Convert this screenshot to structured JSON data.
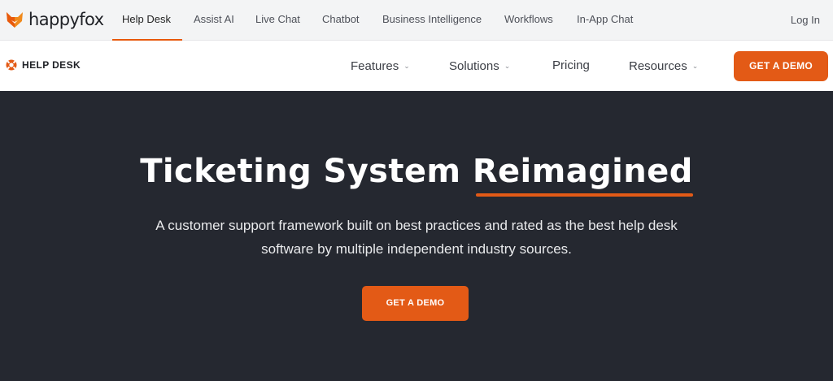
{
  "topbar": {
    "logo_text": "happyfox",
    "products": [
      "Help Desk",
      "Assist AI",
      "Live Chat",
      "Chatbot",
      "Business Intelligence",
      "Workflows",
      "In-App Chat"
    ],
    "active_product": "Help Desk",
    "login_label": "Log In"
  },
  "subnav": {
    "brand_label": "HELP DESK",
    "brand_icon": "lifebuoy-icon",
    "items": [
      {
        "label": "Features",
        "dropdown": true
      },
      {
        "label": "Solutions",
        "dropdown": true
      },
      {
        "label": "Pricing",
        "dropdown": false
      },
      {
        "label": "Resources",
        "dropdown": true
      }
    ],
    "cta_label": "GET A DEMO"
  },
  "hero": {
    "title_main": "Ticketing System ",
    "title_highlight": "Reimagined",
    "subtitle_line1": "A customer support framework built on best practices and rated as the best help desk",
    "subtitle_line2": "software by multiple independent industry sources.",
    "cta_label": "GET A DEMO"
  },
  "colors": {
    "accent": "#e35a16",
    "hero_bg": "#252830",
    "topbar_bg": "#f3f4f5"
  }
}
